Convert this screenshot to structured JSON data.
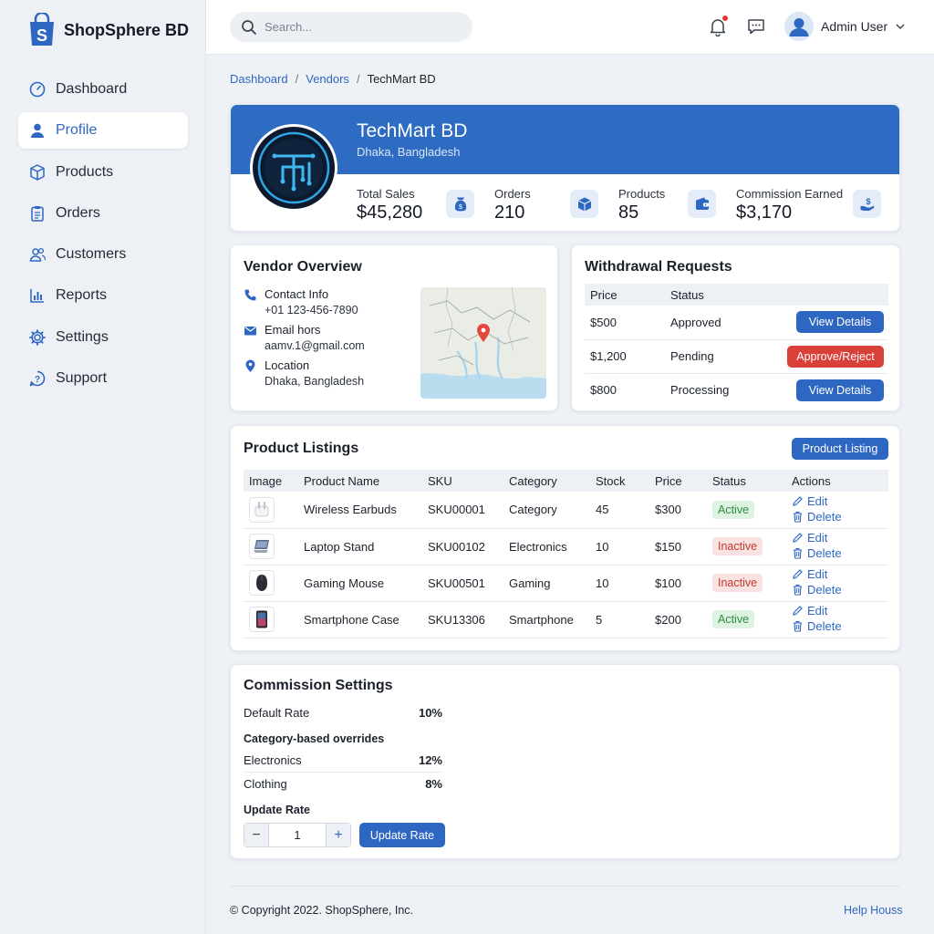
{
  "brand": {
    "name": "ShopSphere BD"
  },
  "sidebar": {
    "items": [
      {
        "label": "Dashboard",
        "icon": "dashboard-icon"
      },
      {
        "label": "Profile",
        "icon": "user-icon",
        "active": true
      },
      {
        "label": "Products",
        "icon": "box-icon"
      },
      {
        "label": "Orders",
        "icon": "clipboard-icon"
      },
      {
        "label": "Customers",
        "icon": "users-icon"
      },
      {
        "label": "Reports",
        "icon": "bar-chart-icon"
      },
      {
        "label": "Settings",
        "icon": "gear-icon"
      },
      {
        "label": "Support",
        "icon": "help-icon"
      }
    ]
  },
  "topbar": {
    "search_placeholder": "Search...",
    "user_name": "Admin User"
  },
  "breadcrumb": {
    "items": [
      "Dashboard",
      "Vendors",
      "TechMart BD"
    ]
  },
  "vendor": {
    "name": "TechMart BD",
    "location": "Dhaka, Bangladesh",
    "stats": [
      {
        "label": "Total Sales",
        "value": "$45,280",
        "icon": "money-bag-icon"
      },
      {
        "label": "Orders",
        "value": "210",
        "icon": "cube-icon"
      },
      {
        "label": "Products",
        "value": "85",
        "icon": "wallet-icon"
      },
      {
        "label": "Commission Earned",
        "value": "$3,170",
        "icon": "hand-dollar-icon"
      }
    ]
  },
  "overview": {
    "title": "Vendor Overview",
    "contact_label": "Contact Info",
    "contact_value": "+01 123-456-7890",
    "email_label": "Email hors",
    "email_value": "aamv.1@gmail.com",
    "location_label": "Location",
    "location_value": "Dhaka, Bangladesh"
  },
  "withdrawals": {
    "title": "Withdrawal Requests",
    "headers": [
      "Price",
      "Status"
    ],
    "rows": [
      {
        "price": "$500",
        "status": "Approved",
        "action": "View Details"
      },
      {
        "price": "$1,200",
        "status": "Pending",
        "action": "Approve/Reject"
      },
      {
        "price": "$800",
        "status": "Processing",
        "action": "View Details"
      }
    ]
  },
  "products": {
    "title": "Product Listings",
    "button": "Product Listing",
    "headers": [
      "Image",
      "Product Name",
      "SKU",
      "Category",
      "Stock",
      "Price",
      "Status",
      "Actions"
    ],
    "edit_label": "Edit",
    "delete_label": "Delete",
    "rows": [
      {
        "name": "Wireless Earbuds",
        "sku": "SKU00001",
        "category": "Category",
        "stock": "45",
        "price": "$300",
        "status": "Active"
      },
      {
        "name": "Laptop Stand",
        "sku": "SKU00102",
        "category": "Electronics",
        "stock": "10",
        "price": "$150",
        "status": "Inactive"
      },
      {
        "name": "Gaming Mouse",
        "sku": "SKU00501",
        "category": "Gaming",
        "stock": "10",
        "price": "$100",
        "status": "Inactive"
      },
      {
        "name": "Smartphone Case",
        "sku": "SKU13306",
        "category": "Smartphone",
        "stock": "5",
        "price": "$200",
        "status": "Active"
      }
    ]
  },
  "commission": {
    "title": "Commission Settings",
    "default_label": "Default Rate",
    "default_value": "10%",
    "overrides_label": "Category-based overrides",
    "overrides": [
      {
        "category": "Electronics",
        "rate": "12%"
      },
      {
        "category": "Clothing",
        "rate": "8%"
      }
    ],
    "update_label": "Update Rate",
    "stepper_value": "1",
    "button": "Update Rate"
  },
  "footer": {
    "copyright": "© Copyright 2022. ShopSphere, Inc.",
    "help": "Help Houss"
  },
  "colors": {
    "primary": "#2e67c2",
    "danger": "#d9403a",
    "success": "#2e8b3d",
    "warning": "#c7861a"
  }
}
